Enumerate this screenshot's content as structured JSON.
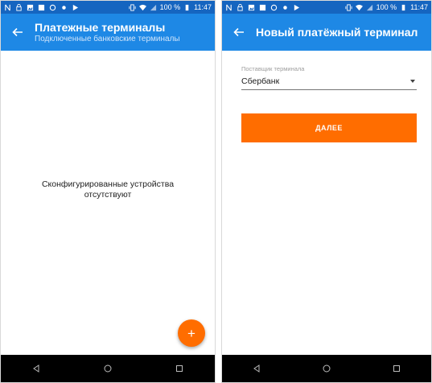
{
  "colors": {
    "status_bar": "#1565c0",
    "app_bar": "#1e88e5",
    "accent": "#ff6d00",
    "nav_bar": "#000000"
  },
  "status_bar": {
    "left_icons": [
      "nfc-icon",
      "lock-icon",
      "image-icon",
      "gallery-icon",
      "sync-icon",
      "shield-icon",
      "play-store-icon"
    ],
    "right_icons": [
      "vibrate-icon",
      "wifi-icon",
      "signal-icon",
      "battery-icon"
    ],
    "battery_text": "100 %",
    "time": "11:47"
  },
  "left_screen": {
    "title": "Платежные терминалы",
    "subtitle": "Подключенные банковские терминалы",
    "empty_line1": "Сконфигурированные устройства",
    "empty_line2": "отсутствуют",
    "fab_label": "+"
  },
  "right_screen": {
    "title": "Новый платёжный терминал",
    "field_label": "Поставщик терминала",
    "selected_value": "Сбербанк",
    "next_button": "ДАЛЕЕ"
  },
  "nav_bar": [
    "back-icon",
    "home-icon",
    "recents-icon"
  ]
}
